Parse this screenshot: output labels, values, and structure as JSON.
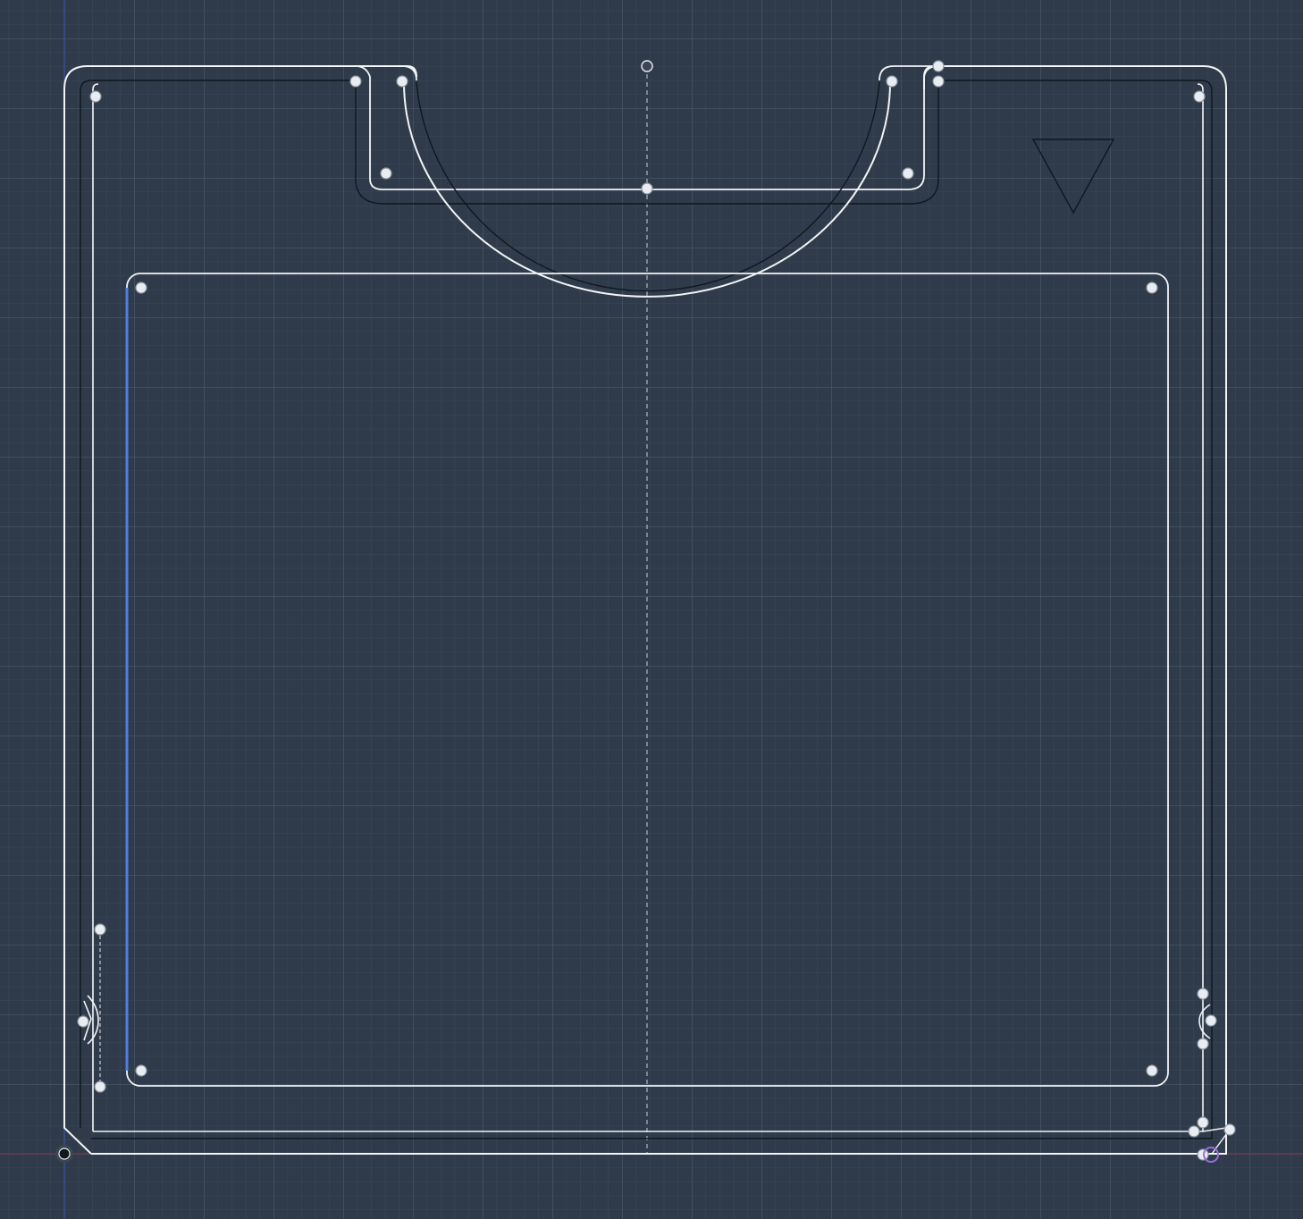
{
  "app": {
    "view": "sketch-canvas"
  },
  "colors": {
    "background": "#2f3b4a",
    "grid_minor": "#3d4959",
    "grid_major": "#4c5a6b",
    "sketch_line": "#f2f5f8",
    "dark_line": "#0f1720",
    "selected_line": "#4f7fe0",
    "axis_x": "#7a3a45",
    "axis_y": "#3a4fa0",
    "point_fill": "#e9edf1",
    "point_stroke": "#8b95a1",
    "origin_fill": "#3c4652",
    "highlight_point": "#9b6be0"
  },
  "canvas": {
    "grid": true,
    "construction_centerline": true,
    "selected_entity": "left-inner-vertical-line"
  }
}
